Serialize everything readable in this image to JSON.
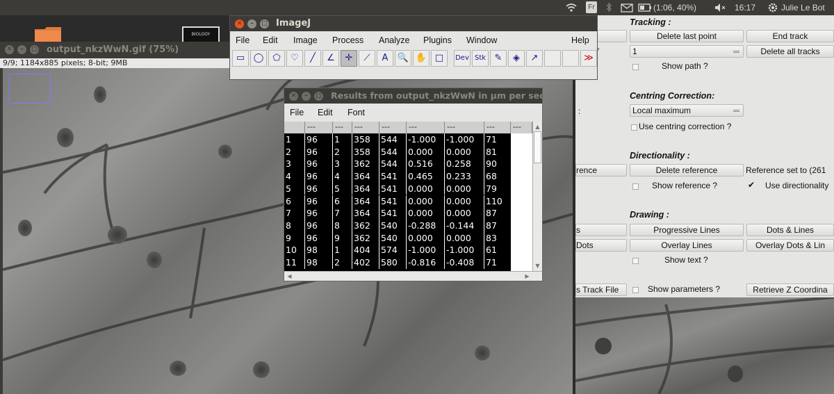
{
  "top_panel": {
    "wifi_icon": "wifi-icon",
    "keyboard_layout": "Fr",
    "battery_status": "(1:06, 40%)",
    "time": "16:17",
    "user_name": "Julie Le Bot"
  },
  "desktop": {
    "folder_icon": "folder-icon",
    "thumbnail_label": "BIOLOGY"
  },
  "image_window": {
    "title": "output_nkzWwN.gif (75%)",
    "info": "9/9; 1184x885 pixels; 8-bit; 9MB"
  },
  "imagej_window": {
    "title": "ImageJ",
    "menu": [
      "File",
      "Edit",
      "Image",
      "Process",
      "Analyze",
      "Plugins",
      "Window",
      "Help"
    ],
    "tools": [
      {
        "name": "rectangle-tool",
        "glyph": "▭"
      },
      {
        "name": "oval-tool",
        "glyph": "◯"
      },
      {
        "name": "polygon-tool",
        "glyph": "⬠"
      },
      {
        "name": "freehand-tool",
        "glyph": "♡"
      },
      {
        "name": "line-tool",
        "glyph": "╱"
      },
      {
        "name": "angle-tool",
        "glyph": "∠"
      },
      {
        "name": "point-tool",
        "glyph": "✛"
      },
      {
        "name": "wand-tool",
        "glyph": "⟋"
      },
      {
        "name": "text-tool",
        "glyph": "A"
      },
      {
        "name": "zoom-tool",
        "glyph": "🔍"
      },
      {
        "name": "hand-tool",
        "glyph": "✋"
      },
      {
        "name": "color-picker-tool",
        "glyph": "□"
      },
      {
        "name": "dev-tool",
        "glyph": "Dev"
      },
      {
        "name": "stk-tool",
        "glyph": "Stk"
      },
      {
        "name": "brush-tool",
        "glyph": "✎"
      },
      {
        "name": "flood-fill-tool",
        "glyph": "◈"
      },
      {
        "name": "arrow-tool",
        "glyph": "↗"
      },
      {
        "name": "blank-tool-1",
        "glyph": ""
      },
      {
        "name": "blank-tool-2",
        "glyph": ""
      },
      {
        "name": "more-tools",
        "glyph": "≫"
      }
    ]
  },
  "results_window": {
    "title": "Results from output_nkzWwN in µm per sec",
    "menu": [
      "File",
      "Edit",
      "Font"
    ],
    "headers": [
      "",
      "---",
      "---",
      "---",
      "---",
      "---",
      "---",
      "---",
      "---"
    ],
    "rows": [
      [
        "1",
        "96",
        "1",
        "358",
        "544",
        "-1.000",
        "-1.000",
        "71"
      ],
      [
        "2",
        "96",
        "2",
        "358",
        "544",
        "0.000",
        "0.000",
        "81"
      ],
      [
        "3",
        "96",
        "3",
        "362",
        "544",
        "0.516",
        "0.258",
        "90"
      ],
      [
        "4",
        "96",
        "4",
        "364",
        "541",
        "0.465",
        "0.233",
        "68"
      ],
      [
        "5",
        "96",
        "5",
        "364",
        "541",
        "0.000",
        "0.000",
        "79"
      ],
      [
        "6",
        "96",
        "6",
        "364",
        "541",
        "0.000",
        "0.000",
        "110"
      ],
      [
        "7",
        "96",
        "7",
        "364",
        "541",
        "0.000",
        "0.000",
        "87"
      ],
      [
        "8",
        "96",
        "8",
        "362",
        "540",
        "-0.288",
        "-0.144",
        "87"
      ],
      [
        "9",
        "96",
        "9",
        "362",
        "540",
        "0.000",
        "0.000",
        "83"
      ],
      [
        "10",
        "98",
        "1",
        "404",
        "574",
        "-1.000",
        "-1.000",
        "61"
      ],
      [
        "11",
        "98",
        "2",
        "402",
        "580",
        "-0.816",
        "-0.408",
        "71"
      ]
    ]
  },
  "tracking_panel": {
    "tracking_title": "Tracking :",
    "delete_last_point": "Delete last point",
    "end_track": "End track",
    "partial_left_label": "°",
    "track_dropdown_value": "1",
    "delete_all_tracks": "Delete all tracks",
    "show_path": "Show path ?",
    "centring_title": "Centring Correction:",
    "centring_colon": ":",
    "centring_dropdown_value": "Local maximum",
    "use_centring": "Use centring correction ?",
    "directionality_title": "Directionality :",
    "add_reference_partial": "rence",
    "delete_reference": "Delete reference",
    "reference_set_to": "Reference set to (261",
    "show_reference": "Show reference ?",
    "use_directionality": "Use directionality",
    "drawing_title": "Drawing :",
    "dots_partial": "s",
    "progressive_lines": "Progressive Lines",
    "dots_and_lines": "Dots & Lines",
    "overlay_dots_partial": "Dots",
    "overlay_lines": "Overlay Lines",
    "overlay_dots_and_lines": "Overlay Dots & Lin",
    "show_text": "Show text ?",
    "load_track_file_partial": "s Track File",
    "show_parameters": "Show parameters ?",
    "retrieve_z": "Retrieve Z Coordina",
    "checkmark": "✔"
  }
}
